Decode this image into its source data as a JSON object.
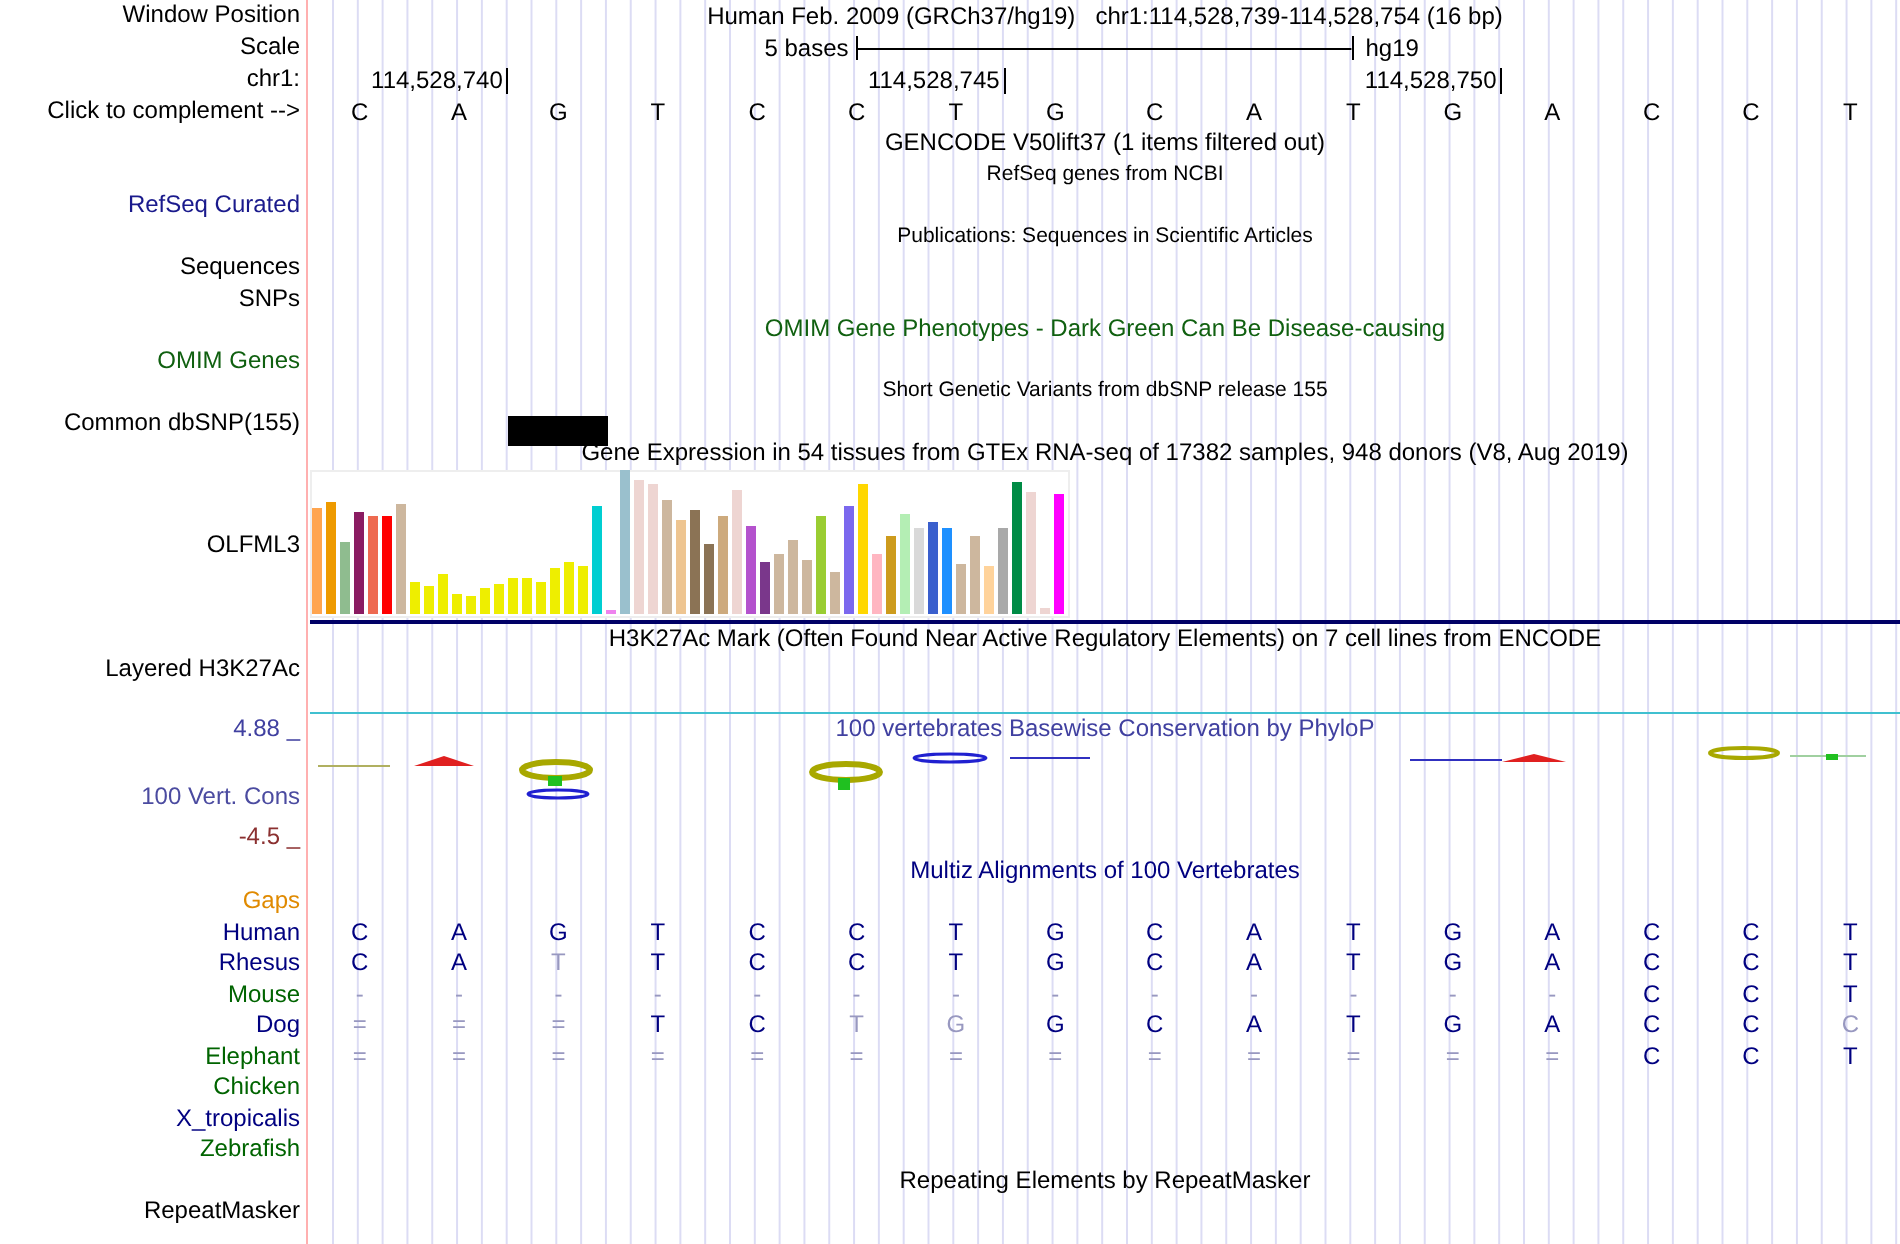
{
  "header": {
    "label": "Window Position",
    "assembly": "Human Feb. 2009 (GRCh37/hg19)",
    "position": "chr1:114,528,739-114,528,754 (16 bp)"
  },
  "scale": {
    "label": "Scale",
    "length": "5 bases",
    "assembly": "hg19"
  },
  "ruler": {
    "label": "chr1:",
    "ticks": [
      "114,528,740",
      "114,528,745",
      "114,528,750"
    ]
  },
  "sequence": {
    "label": "Click to complement -->",
    "bases": [
      "C",
      "A",
      "G",
      "T",
      "C",
      "C",
      "T",
      "G",
      "C",
      "A",
      "T",
      "G",
      "A",
      "C",
      "C",
      "T"
    ]
  },
  "tracks": [
    {
      "kind": "gene",
      "title": "GENCODE V50lift37 (1 items filtered out)",
      "color": "#000000"
    },
    {
      "kind": "summary",
      "title": "RefSeq genes from NCBI",
      "color": "#000000",
      "labels": [
        {
          "text": "RefSeq Curated",
          "color": "#1a1a8c"
        }
      ]
    },
    {
      "kind": "summary",
      "title": "Publications: Sequences in Scientific Articles",
      "color": "#000000",
      "labels": [
        {
          "text": "Sequences",
          "color": "#000000"
        },
        {
          "text": "SNPs",
          "color": "#000000"
        }
      ]
    },
    {
      "kind": "gene",
      "title": "OMIM Gene Phenotypes - Dark Green Can Be Disease-causing",
      "color": "#106010",
      "labels": [
        {
          "text": "OMIM Genes",
          "color": "#106010"
        }
      ]
    },
    {
      "kind": "snp",
      "title": "Short Genetic Variants from dbSNP release 155",
      "color": "#000000",
      "labels": [
        {
          "text": "Common dbSNP(155)",
          "color": "#000000"
        }
      ]
    },
    {
      "kind": "expression",
      "title": "Gene Expression in 54 tissues from GTEx RNA-seq of 17382 samples, 948 donors (V8, Aug 2019)",
      "color": "#000000",
      "labels": [
        {
          "text": "OLFML3",
          "color": "#000000"
        }
      ]
    },
    {
      "kind": "signal",
      "title": "H3K27Ac Mark (Often Found Near Active Regulatory Elements) on 7 cell lines from ENCODE",
      "color": "#000000",
      "labels": [
        {
          "text": "Layered H3K27Ac",
          "color": "#000000"
        }
      ]
    },
    {
      "kind": "conservation",
      "title": "100 vertebrates Basewise Conservation by PhyloP",
      "color": "#4040a0",
      "scale_max": "4.88 _",
      "scale_min": "-4.5 _",
      "labels": [
        {
          "text": "100 Vert. Cons",
          "color": "#4b4ba0"
        }
      ]
    },
    {
      "kind": "alignment",
      "title": "Multiz Alignments of 100 Vertebrates",
      "color": "#000080",
      "species": [
        {
          "name": "Gaps",
          "color": "#e08a00"
        },
        {
          "name": "Human",
          "color": "#000080",
          "bases": [
            {
              "base": "C",
              "faded": false
            },
            {
              "base": "A",
              "faded": false
            },
            {
              "base": "G",
              "faded": false
            },
            {
              "base": "T",
              "faded": false
            },
            {
              "base": "C",
              "faded": false
            },
            {
              "base": "C",
              "faded": false
            },
            {
              "base": "T",
              "faded": false
            },
            {
              "base": "G",
              "faded": false
            },
            {
              "base": "C",
              "faded": false
            },
            {
              "base": "A",
              "faded": false
            },
            {
              "base": "T",
              "faded": false
            },
            {
              "base": "G",
              "faded": false
            },
            {
              "base": "A",
              "faded": false
            },
            {
              "base": "C",
              "faded": false
            },
            {
              "base": "C",
              "faded": false
            },
            {
              "base": "T",
              "faded": false
            }
          ]
        },
        {
          "name": "Rhesus",
          "color": "#000080",
          "bases": [
            {
              "base": "C",
              "faded": false
            },
            {
              "base": "A",
              "faded": false
            },
            {
              "base": "T",
              "faded": true
            },
            {
              "base": "T",
              "faded": false
            },
            {
              "base": "C",
              "faded": false
            },
            {
              "base": "C",
              "faded": false
            },
            {
              "base": "T",
              "faded": false
            },
            {
              "base": "G",
              "faded": false
            },
            {
              "base": "C",
              "faded": false
            },
            {
              "base": "A",
              "faded": false
            },
            {
              "base": "T",
              "faded": false
            },
            {
              "base": "G",
              "faded": false
            },
            {
              "base": "A",
              "faded": false
            },
            {
              "base": "C",
              "faded": false
            },
            {
              "base": "C",
              "faded": false
            },
            {
              "base": "T",
              "faded": false
            }
          ]
        },
        {
          "name": "Mouse",
          "color": "#006400",
          "bases": [
            {
              "base": "-",
              "faded": true
            },
            {
              "base": "-",
              "faded": true
            },
            {
              "base": "-",
              "faded": true
            },
            {
              "base": "-",
              "faded": true
            },
            {
              "base": "-",
              "faded": true
            },
            {
              "base": "-",
              "faded": true
            },
            {
              "base": "-",
              "faded": true
            },
            {
              "base": "-",
              "faded": true
            },
            {
              "base": "-",
              "faded": true
            },
            {
              "base": "-",
              "faded": true
            },
            {
              "base": "-",
              "faded": true
            },
            {
              "base": "-",
              "faded": true
            },
            {
              "base": "-",
              "faded": true
            },
            {
              "base": "C",
              "faded": false
            },
            {
              "base": "C",
              "faded": false
            },
            {
              "base": "T",
              "faded": false
            }
          ]
        },
        {
          "name": "Dog",
          "color": "#000080",
          "bases": [
            {
              "base": "=",
              "faded": true
            },
            {
              "base": "=",
              "faded": true
            },
            {
              "base": "=",
              "faded": true
            },
            {
              "base": "T",
              "faded": false
            },
            {
              "base": "C",
              "faded": false
            },
            {
              "base": "T",
              "faded": true
            },
            {
              "base": "G",
              "faded": true
            },
            {
              "base": "G",
              "faded": false
            },
            {
              "base": "C",
              "faded": false
            },
            {
              "base": "A",
              "faded": false
            },
            {
              "base": "T",
              "faded": false
            },
            {
              "base": "G",
              "faded": false
            },
            {
              "base": "A",
              "faded": false
            },
            {
              "base": "C",
              "faded": false
            },
            {
              "base": "C",
              "faded": false
            },
            {
              "base": "C",
              "faded": true
            }
          ]
        },
        {
          "name": "Elephant",
          "color": "#006400",
          "bases": [
            {
              "base": "=",
              "faded": true
            },
            {
              "base": "=",
              "faded": true
            },
            {
              "base": "=",
              "faded": true
            },
            {
              "base": "=",
              "faded": true
            },
            {
              "base": "=",
              "faded": true
            },
            {
              "base": "=",
              "faded": true
            },
            {
              "base": "=",
              "faded": true
            },
            {
              "base": "=",
              "faded": true
            },
            {
              "base": "=",
              "faded": true
            },
            {
              "base": "=",
              "faded": true
            },
            {
              "base": "=",
              "faded": true
            },
            {
              "base": "=",
              "faded": true
            },
            {
              "base": "=",
              "faded": true
            },
            {
              "base": "C",
              "faded": false
            },
            {
              "base": "C",
              "faded": false
            },
            {
              "base": "T",
              "faded": false
            }
          ]
        },
        {
          "name": "Chicken",
          "color": "#006400"
        },
        {
          "name": "X_tropicalis",
          "color": "#000080"
        },
        {
          "name": "Zebrafish",
          "color": "#006400"
        }
      ]
    },
    {
      "kind": "repeat",
      "title": "Repeating Elements by RepeatMasker",
      "color": "#000000",
      "labels": [
        {
          "text": "RepeatMasker",
          "color": "#000000"
        }
      ]
    }
  ]
}
